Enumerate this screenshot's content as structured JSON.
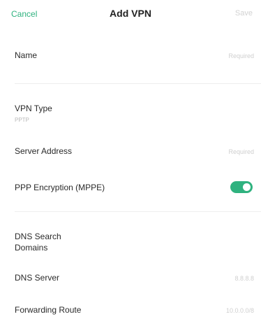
{
  "header": {
    "cancel_label": "Cancel",
    "title": "Add VPN",
    "save_label": "Save"
  },
  "form": {
    "name": {
      "label": "Name",
      "placeholder": "Required"
    },
    "vpn_type": {
      "label": "VPN Type",
      "value": "PPTP"
    },
    "server_address": {
      "label": "Server Address",
      "placeholder": "Required"
    },
    "ppp_encryption": {
      "label": "PPP Encryption (MPPE)",
      "enabled": true
    },
    "dns_search_domains": {
      "label_line1": "DNS Search",
      "label_line2": "Domains"
    },
    "dns_server": {
      "label": "DNS Server",
      "placeholder": "8.8.8.8"
    },
    "forwarding_route": {
      "label": "Forwarding Route",
      "placeholder": "10.0.0.0/8"
    }
  },
  "colors": {
    "accent": "#2fb27f",
    "placeholder": "#cfcfcf",
    "divider": "#eeeeee"
  }
}
